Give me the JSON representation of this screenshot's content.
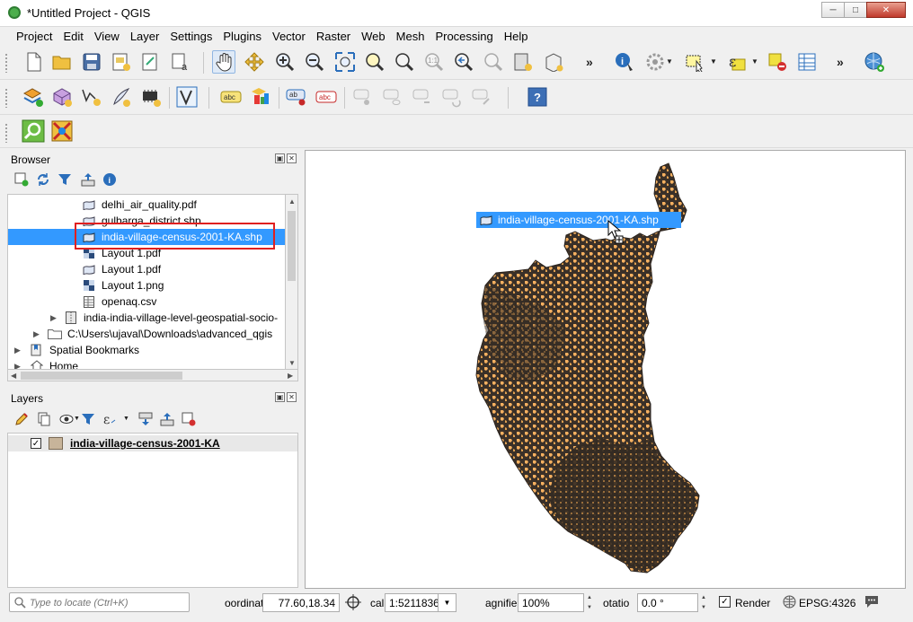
{
  "window": {
    "title": "*Untitled Project - QGIS"
  },
  "menu": [
    "Project",
    "Edit",
    "View",
    "Layer",
    "Settings",
    "Plugins",
    "Vector",
    "Raster",
    "Web",
    "Mesh",
    "Processing",
    "Help"
  ],
  "toolbar_overflow": "»",
  "browser": {
    "title": "Browser",
    "items": [
      {
        "label": "delhi_air_quality.pdf",
        "icon": "vector-file-icon"
      },
      {
        "label": "gulbarga_district.shp",
        "icon": "vector-file-icon"
      },
      {
        "label": "india-village-census-2001-KA.shp",
        "icon": "vector-file-icon"
      },
      {
        "label": "Layout 1.pdf",
        "icon": "raster-file-icon"
      },
      {
        "label": "Layout 1.pdf",
        "icon": "vector-file-icon"
      },
      {
        "label": "Layout 1.png",
        "icon": "raster-file-icon"
      },
      {
        "label": "openaq.csv",
        "icon": "table-file-icon"
      },
      {
        "label": "india-india-village-level-geospatial-socio-",
        "icon": "archive-icon"
      },
      {
        "label": "C:\\Users\\ujaval\\Downloads\\advanced_qgis",
        "icon": "folder-icon"
      },
      {
        "label": "Spatial Bookmarks",
        "icon": "bookmarks-icon"
      },
      {
        "label": "Home",
        "icon": "home-icon"
      }
    ]
  },
  "layers": {
    "title": "Layers",
    "items": [
      {
        "label": "india-village-census-2001-KA",
        "checked": true,
        "fill_color": "#c7b49a"
      }
    ]
  },
  "drag_label": "india-village-census-2001-KA.shp",
  "status": {
    "locate_placeholder": "Type to locate (Ctrl+K)",
    "coordinate_label": "oordinat",
    "coordinate_value": "77.60,18.34",
    "scale_label": "cal",
    "scale_value": "1:5211836",
    "magnifier_label": "agnifie",
    "magnifier_value": "100%",
    "rotation_label": "otatio",
    "rotation_value": "0.0 °",
    "render_label": "Render",
    "render_checked": true,
    "crs": "EPSG:4326"
  },
  "colors": {
    "selection": "#3399ff",
    "map_fill": "#f5b060",
    "map_boundary": "#3a3028",
    "highlight_box": "#e02020"
  }
}
